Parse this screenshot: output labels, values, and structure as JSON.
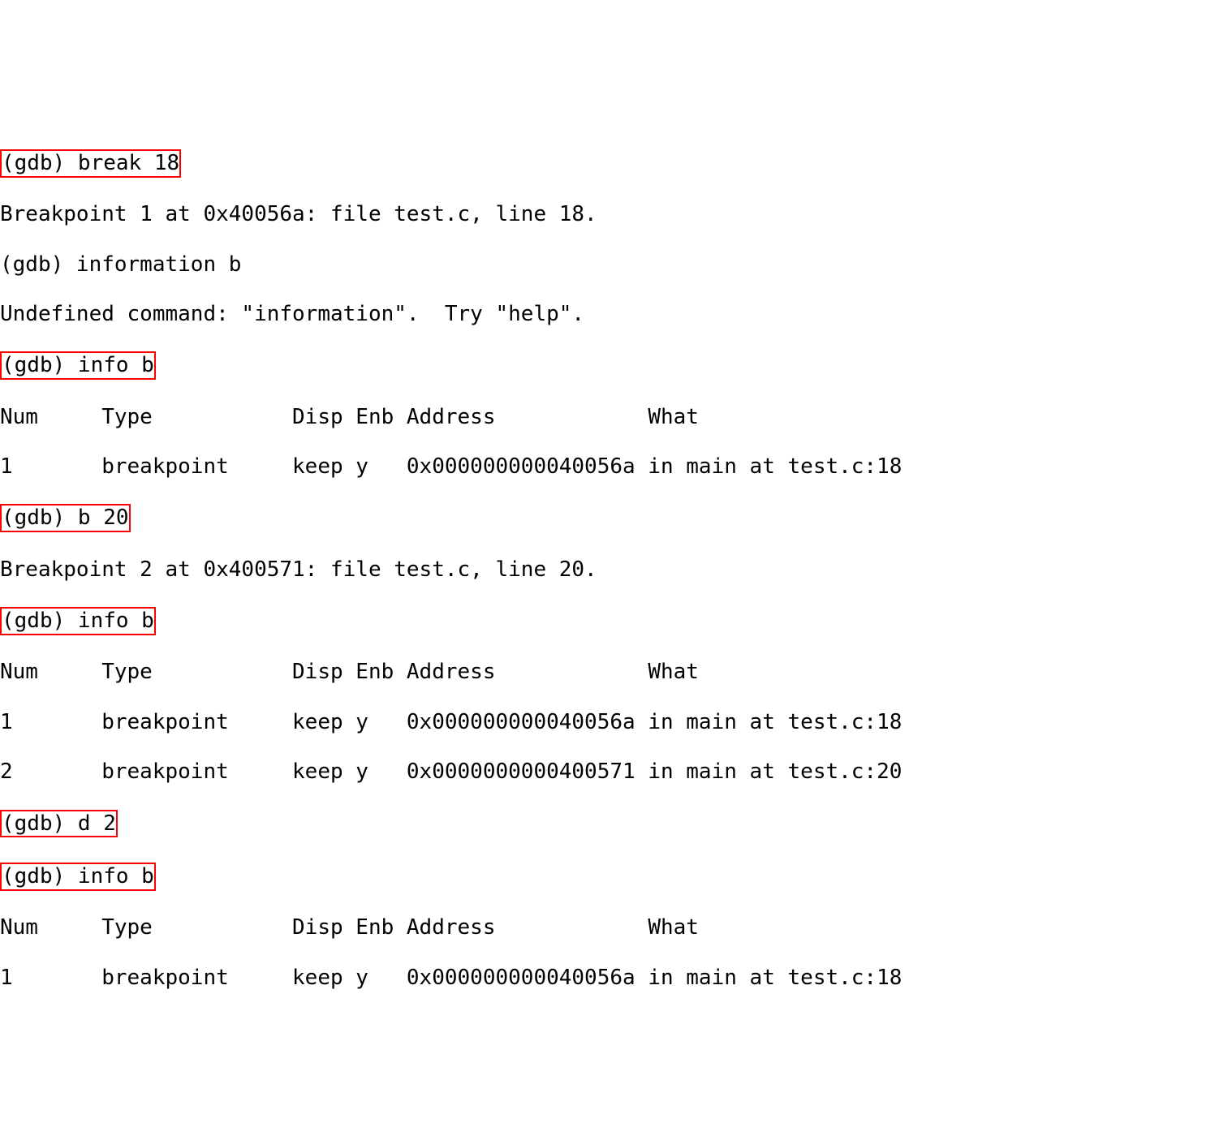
{
  "lines": {
    "l1_cmd": "(gdb) break 18",
    "l2_out": "Breakpoint 1 at 0x40056a: file test.c, line 18.",
    "l3_cmd": "(gdb) information b",
    "l4_out": "Undefined command: \"information\".  Try \"help\".",
    "l5_cmd": "(gdb) info b",
    "l6_hdr": "Num     Type           Disp Enb Address            What",
    "l7_row": "1       breakpoint     keep y   0x000000000040056a in main at test.c:18",
    "l8_cmd": "(gdb) b 20",
    "l9_out": "Breakpoint 2 at 0x400571: file test.c, line 20.",
    "l10_cmd": "(gdb) info b",
    "l11_hdr": "Num     Type           Disp Enb Address            What",
    "l12_row": "1       breakpoint     keep y   0x000000000040056a in main at test.c:18",
    "l13_row": "2       breakpoint     keep y   0x0000000000400571 in main at test.c:20",
    "l14_cmd": "(gdb) d 2",
    "l15_cmd": "(gdb) info b",
    "l16_hdr": "Num     Type           Disp Enb Address            What",
    "l17_row": "1       breakpoint     keep y   0x000000000040056a in main at test.c:18"
  }
}
